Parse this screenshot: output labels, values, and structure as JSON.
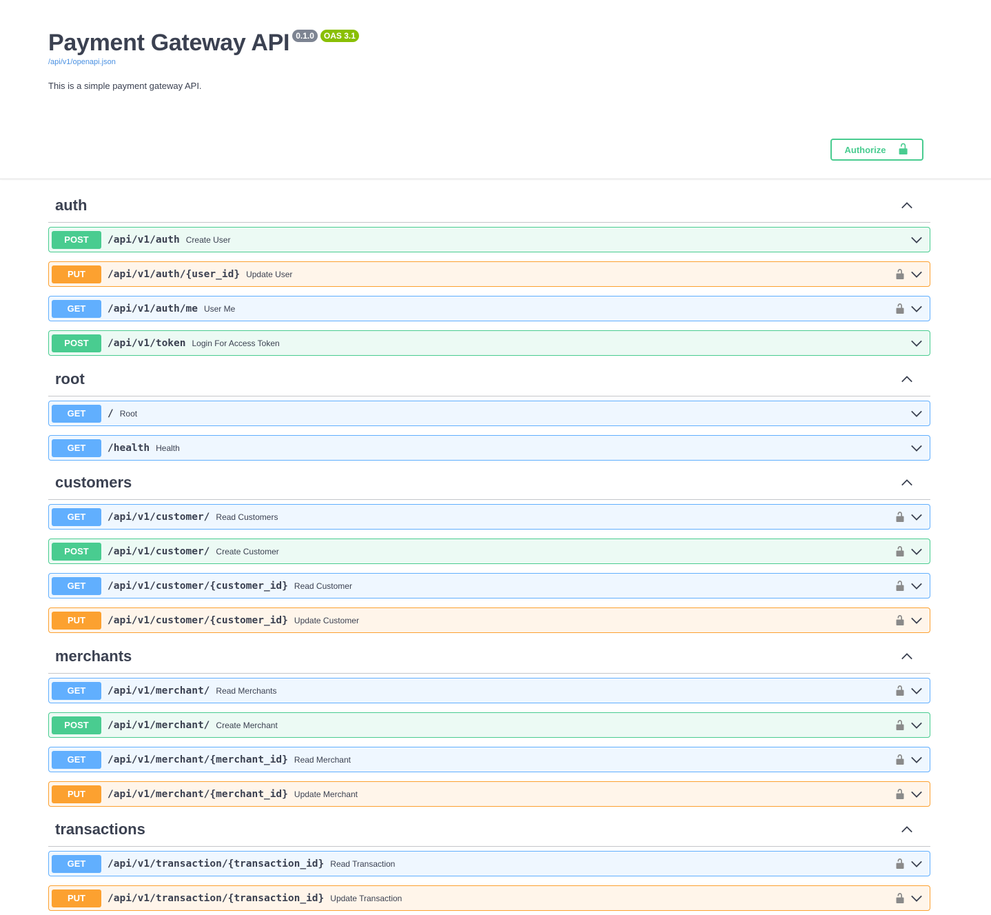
{
  "info": {
    "title": "Payment Gateway API",
    "version": "0.1.0",
    "oas": "OAS 3.1",
    "spec_url": "/api/v1/openapi.json",
    "description": "This is a simple payment gateway API."
  },
  "authorize": {
    "label": "Authorize",
    "icon": "unlock-icon"
  },
  "colors": {
    "get": "#61affe",
    "post": "#49cc90",
    "put": "#fca130",
    "authorize": "#49cc90"
  },
  "tags": [
    {
      "name": "auth",
      "operations": [
        {
          "method": "POST",
          "path": "/api/v1/auth",
          "summary": "Create User",
          "locked": false
        },
        {
          "method": "PUT",
          "path": "/api/v1/auth/{user_id}",
          "summary": "Update User",
          "locked": true
        },
        {
          "method": "GET",
          "path": "/api/v1/auth/me",
          "summary": "User Me",
          "locked": true
        },
        {
          "method": "POST",
          "path": "/api/v1/token",
          "summary": "Login For Access Token",
          "locked": false
        }
      ]
    },
    {
      "name": "root",
      "operations": [
        {
          "method": "GET",
          "path": "/",
          "summary": "Root",
          "locked": false
        },
        {
          "method": "GET",
          "path": "/health",
          "summary": "Health",
          "locked": false
        }
      ]
    },
    {
      "name": "customers",
      "operations": [
        {
          "method": "GET",
          "path": "/api/v1/customer/",
          "summary": "Read Customers",
          "locked": true
        },
        {
          "method": "POST",
          "path": "/api/v1/customer/",
          "summary": "Create Customer",
          "locked": true
        },
        {
          "method": "GET",
          "path": "/api/v1/customer/{customer_id}",
          "summary": "Read Customer",
          "locked": true
        },
        {
          "method": "PUT",
          "path": "/api/v1/customer/{customer_id}",
          "summary": "Update Customer",
          "locked": true
        }
      ]
    },
    {
      "name": "merchants",
      "operations": [
        {
          "method": "GET",
          "path": "/api/v1/merchant/",
          "summary": "Read Merchants",
          "locked": true
        },
        {
          "method": "POST",
          "path": "/api/v1/merchant/",
          "summary": "Create Merchant",
          "locked": true
        },
        {
          "method": "GET",
          "path": "/api/v1/merchant/{merchant_id}",
          "summary": "Read Merchant",
          "locked": true
        },
        {
          "method": "PUT",
          "path": "/api/v1/merchant/{merchant_id}",
          "summary": "Update Merchant",
          "locked": true
        }
      ]
    },
    {
      "name": "transactions",
      "operations": [
        {
          "method": "GET",
          "path": "/api/v1/transaction/{transaction_id}",
          "summary": "Read Transaction",
          "locked": true
        },
        {
          "method": "PUT",
          "path": "/api/v1/transaction/{transaction_id}",
          "summary": "Update Transaction",
          "locked": true
        }
      ]
    }
  ]
}
